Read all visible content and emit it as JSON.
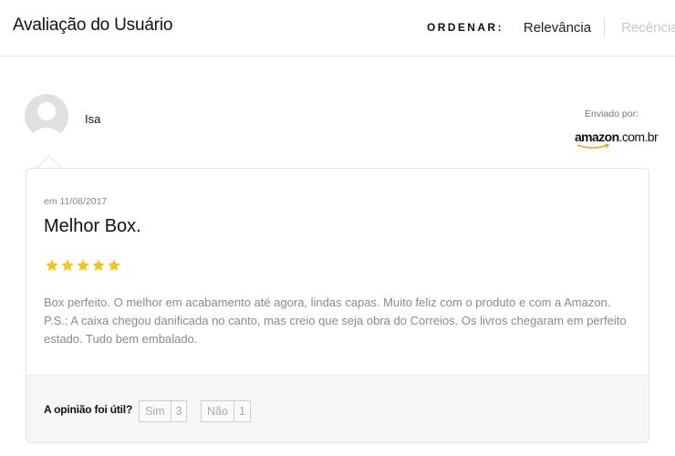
{
  "header": {
    "title": "Avaliação do Usuário",
    "sort_label": "ORDENAR:",
    "sort_options": [
      {
        "label": "Relevância",
        "active": true
      },
      {
        "label": "Recência",
        "active": false
      }
    ]
  },
  "reviewer": {
    "name": "Isa",
    "avatar_icon": "user-silhouette-icon"
  },
  "source": {
    "sent_by_label": "Enviado por:",
    "logo_text_bold": "amazon",
    "logo_text_light": ".com.br"
  },
  "review": {
    "date": "em 11/08/2017",
    "title": "Melhor Box.",
    "rating": 5,
    "rating_max": 5,
    "body": "Box perfeito. O melhor em acabamento até agora, lindas capas. Muito feliz com o produto e com a Amazon. P.S.: A caixa chegou danificada no canto, mas creio que seja obra do Correios. Os livros chegaram em perfeito estado. Tudo bem embalado."
  },
  "helpful": {
    "question": "A opinião foi útil?",
    "yes_label": "Sim",
    "yes_count": "3",
    "no_label": "Não",
    "no_count": "1"
  },
  "colors": {
    "star": "#f5c518",
    "amazon_smile": "#f0a020",
    "avatar": "#e0e0e0"
  }
}
